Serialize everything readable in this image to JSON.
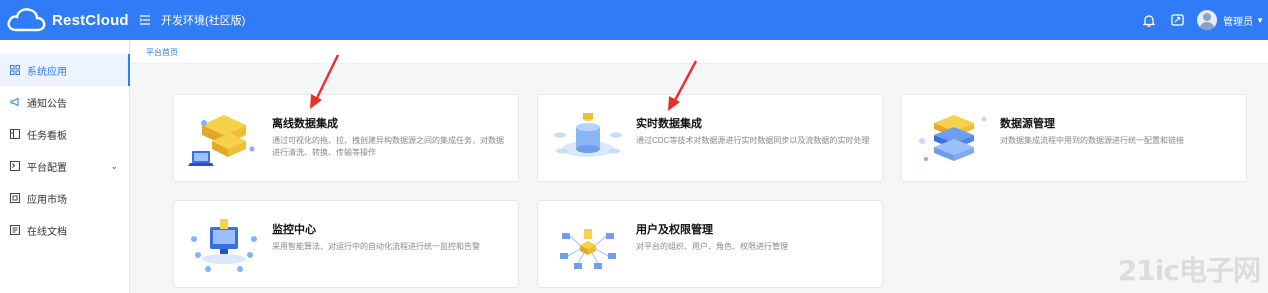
{
  "app": {
    "logo_text": "RestCloud",
    "env_title": "开发环境(社区版)"
  },
  "header": {
    "user_name": "管理员"
  },
  "sidebar": {
    "items": [
      {
        "label": "系统应用",
        "icon": "grid-icon"
      },
      {
        "label": "通知公告",
        "icon": "megaphone-icon"
      },
      {
        "label": "任务看板",
        "icon": "board-icon"
      },
      {
        "label": "平台配置",
        "icon": "config-icon"
      },
      {
        "label": "应用市场",
        "icon": "store-icon"
      },
      {
        "label": "在线文档",
        "icon": "document-icon"
      }
    ]
  },
  "breadcrumb": {
    "home": "平台首页"
  },
  "cards": [
    {
      "title": "离线数据集成",
      "desc": "通过可视化的拖、拉、拽创建异构数据源之间的集成任务，对数据进行清洗、转换、传输等操作",
      "icon": "etl-illustration"
    },
    {
      "title": "实时数据集成",
      "desc": "通过CDC等技术对数据源进行实时数据同步以及流数据的实时处理",
      "icon": "cdc-illustration"
    },
    {
      "title": "数据源管理",
      "desc": "对数据集成流程中用到的数据源进行统一配置和链接",
      "icon": "datasource-illustration"
    },
    {
      "title": "监控中心",
      "desc": "采用智能算法、对运行中的自动化流程进行统一监控和告警",
      "icon": "monitor-illustration"
    },
    {
      "title": "用户及权限管理",
      "desc": "对平台的组织、用户、角色、权限进行管理",
      "icon": "permission-illustration"
    }
  ],
  "watermark": {
    "text": "21ic电子网"
  },
  "colors": {
    "primary": "#2f7cf6",
    "annotation_arrow": "#e8302a"
  }
}
